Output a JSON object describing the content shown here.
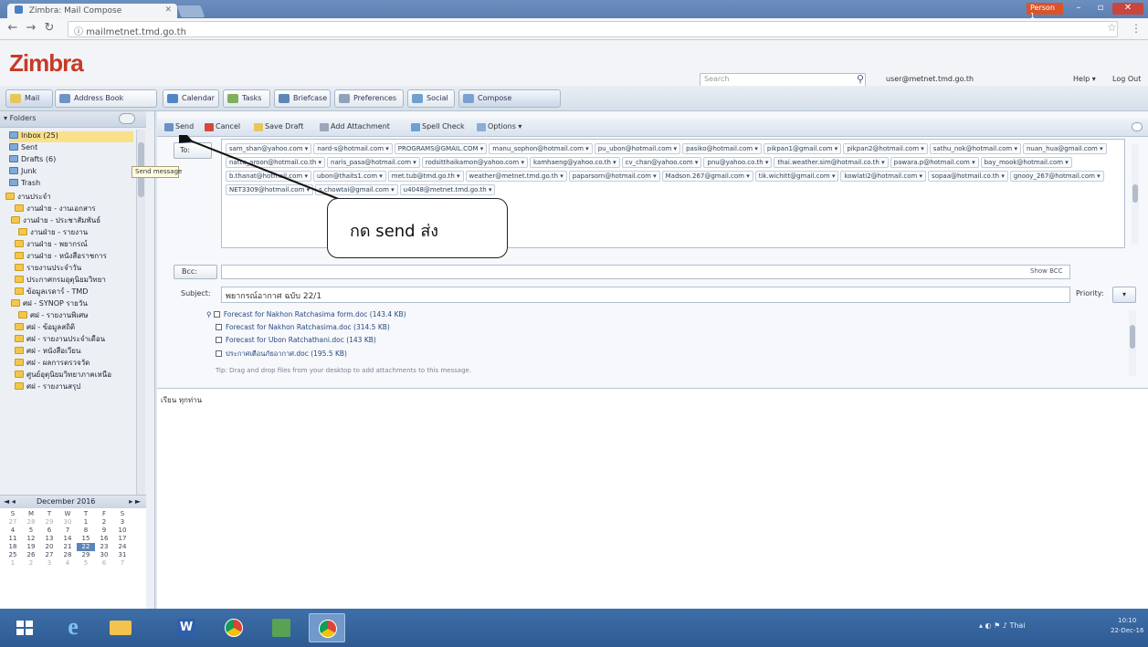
{
  "browser": {
    "tab_title": "Zimbra: Mail Compose",
    "url": "mailmetnet.tmd.go.th",
    "profile_label": "Person 1"
  },
  "zimbra": {
    "logo": "Zimbra",
    "search_placeholder": "Search",
    "user_email": "user@metnet.tmd.go.th",
    "help": "Help ▾",
    "logout": "Log Out"
  },
  "app_tabs": [
    {
      "label": "Mail"
    },
    {
      "label": "Address Book"
    },
    {
      "label": "Calendar"
    },
    {
      "label": "Tasks"
    },
    {
      "label": "Briefcase"
    },
    {
      "label": "Preferences"
    },
    {
      "label": "Social"
    },
    {
      "label": "Compose"
    }
  ],
  "sidebar": {
    "header": "Folders",
    "folders": [
      "Inbox (25)",
      "Sent",
      "Drafts (6)",
      "Junk",
      "Trash",
      "งานประจำ",
      "งานฝ่าย - งานเอกสาร",
      "งานฝ่าย - ประชาสัมพันธ์",
      "งานฝ่าย - รายงาน",
      "งานฝ่าย - พยากรณ์",
      "งานฝ่าย - หนังสือราชการ",
      "รายงานประจำวัน",
      "ประกาศกรมอุตุนิยมวิทยา",
      "ข้อมูลเรดาร์ - TMD",
      "ศฝ - SYNOP รายวัน",
      "ศฝ - รายงานพิเศษ",
      "ศฝ - ข้อมูลสถิติ",
      "ศฝ - รายงานประจำเดือน",
      "ศฝ - หนังสือเวียน",
      "ศฝ - ผลการตรวจวัด",
      "ศูนย์อุตุนิยมวิทยาภาคเหนือ",
      "ศฝ - รายงานสรุป"
    ]
  },
  "calendar": {
    "month": "December 2016",
    "prev": "◄ ◂",
    "next": "▸ ►",
    "weekdays": [
      "S",
      "M",
      "T",
      "W",
      "T",
      "F",
      "S"
    ],
    "days": [
      "27",
      "28",
      "29",
      "30",
      "1",
      "2",
      "3",
      "4",
      "5",
      "6",
      "7",
      "8",
      "9",
      "10",
      "11",
      "12",
      "13",
      "14",
      "15",
      "16",
      "17",
      "18",
      "19",
      "20",
      "21",
      "22",
      "23",
      "24",
      "25",
      "26",
      "27",
      "28",
      "29",
      "30",
      "31",
      "1",
      "2",
      "3",
      "4",
      "5",
      "6",
      "7"
    ],
    "today_index": 25,
    "dim_first": 4,
    "dim_last_from": 35
  },
  "compose_toolbar": {
    "send": "Send",
    "cancel": "Cancel",
    "save_draft": "Save Draft",
    "add_attachment": "Add Attachment",
    "spell_check": "Spell Check",
    "options": "Options ▾"
  },
  "recipients": {
    "to_label": "To:",
    "tooltip": "Send message",
    "chips": [
      "sam_shan@yahoo.com",
      "nard-s@hotmail.com",
      "PROGRAMS@GMAIL.COM",
      "manu_sophon@hotmail.com",
      "pu_ubon@hotmail.com",
      "pasiko@hotmail.com",
      "pikpan1@gmail.com",
      "pikpan2@hotmail.com",
      "sathu_nok@hotmail.com",
      "nuan_hua@gmail.com",
      "nattu_aroon@hotmail.co.th",
      "naris_pasa@hotmail.com",
      "rodsitthaikamon@yahoo.com",
      "kamhaeng@yahoo.co.th",
      "cv_chan@yahoo.com",
      "pnu@yahoo.co.th",
      "thai.weather.sim@hotmail.co.th",
      "pawara.p@hotmail.com",
      "bay_mook@hotmail.com",
      "b.thanat@hotmail.com",
      "ubon@thaits1.com",
      "met.tub@tmd.go.th",
      "weather@metnet.tmd.go.th",
      "paparsorn@hotmail.com",
      "Madson.267@gmail.com",
      "tik.wichitt@gmail.com",
      "kowlati2@hotmail.com",
      "sopaa@hotmail.co.th",
      "gnooy_267@hotmail.com",
      "NET3309@hotmail.com",
      "s.chowtai@gmail.com",
      "u4048@metnet.tmd.go.th"
    ]
  },
  "bcc": {
    "label": "Bcc:",
    "show": "Show BCC"
  },
  "subject": {
    "label": "Subject:",
    "value": "พยากรณ์อากาศ ฉบับ 22/1",
    "priority_label": "Priority:",
    "priority_value": "▾"
  },
  "attachments": {
    "items": [
      "Forecast for Nakhon Ratchasima form.doc (143.4 KB)",
      "Forecast for Nakhon Ratchasima.doc (314.5 KB)",
      "Forecast for Ubon Ratchathani.doc (143 KB)",
      "ประกาศเตือนภัยอากาศ.doc (195.5 KB)"
    ],
    "hint": "Tip: Drag and drop files from your desktop to add attachments to this message."
  },
  "body": {
    "text": "เรียน ทุกท่าน"
  },
  "callout": {
    "text": "กด send ส่ง"
  },
  "taskbar": {
    "tray": "▴  ◐  ⚑  ♪  Thai",
    "clock_time": "10:10",
    "clock_date": "22-Dec-16"
  }
}
